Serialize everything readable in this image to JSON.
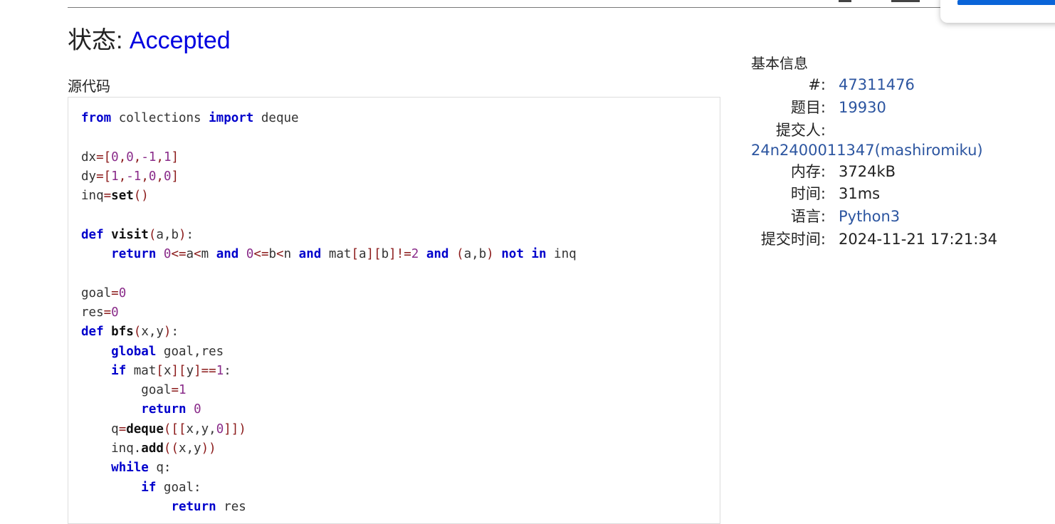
{
  "status": {
    "label": "状态: ",
    "value": "Accepted"
  },
  "source": {
    "title": "源代码",
    "lines": [
      [
        [
          "kw",
          "from"
        ],
        [
          "t",
          " collections "
        ],
        [
          "kw",
          "import"
        ],
        [
          "t",
          " deque"
        ]
      ],
      [],
      [
        [
          "t",
          "dx"
        ],
        [
          "pu",
          "=["
        ],
        [
          "nm",
          "0"
        ],
        [
          "pu",
          ","
        ],
        [
          "nm",
          "0"
        ],
        [
          "pu",
          ","
        ],
        [
          "nm",
          "-1"
        ],
        [
          "pu",
          ","
        ],
        [
          "nm",
          "1"
        ],
        [
          "pu",
          "]"
        ]
      ],
      [
        [
          "t",
          "dy"
        ],
        [
          "pu",
          "=["
        ],
        [
          "nm",
          "1"
        ],
        [
          "pu",
          ","
        ],
        [
          "nm",
          "-1"
        ],
        [
          "pu",
          ","
        ],
        [
          "nm",
          "0"
        ],
        [
          "pu",
          ","
        ],
        [
          "nm",
          "0"
        ],
        [
          "pu",
          "]"
        ]
      ],
      [
        [
          "t",
          "inq"
        ],
        [
          "pu",
          "="
        ],
        [
          "fn",
          "set"
        ],
        [
          "pu",
          "()"
        ]
      ],
      [],
      [
        [
          "kw",
          "def"
        ],
        [
          "t",
          " "
        ],
        [
          "fn",
          "visit"
        ],
        [
          "pu",
          "("
        ],
        [
          "t",
          "a,b"
        ],
        [
          "pu",
          ")"
        ],
        [
          "t",
          ":"
        ]
      ],
      [
        [
          "t",
          "    "
        ],
        [
          "kw",
          "return"
        ],
        [
          "t",
          " "
        ],
        [
          "nm",
          "0"
        ],
        [
          "pu",
          "<="
        ],
        [
          "t",
          "a"
        ],
        [
          "pu",
          "<"
        ],
        [
          "t",
          "m "
        ],
        [
          "kw",
          "and"
        ],
        [
          "t",
          " "
        ],
        [
          "nm",
          "0"
        ],
        [
          "pu",
          "<="
        ],
        [
          "t",
          "b"
        ],
        [
          "pu",
          "<"
        ],
        [
          "t",
          "n "
        ],
        [
          "kw",
          "and"
        ],
        [
          "t",
          " mat"
        ],
        [
          "pu",
          "["
        ],
        [
          "t",
          "a"
        ],
        [
          "pu",
          "]["
        ],
        [
          "t",
          "b"
        ],
        [
          "pu",
          "]!="
        ],
        [
          "nm",
          "2"
        ],
        [
          "t",
          " "
        ],
        [
          "kw",
          "and"
        ],
        [
          "t",
          " "
        ],
        [
          "pu",
          "("
        ],
        [
          "t",
          "a,b"
        ],
        [
          "pu",
          ")"
        ],
        [
          "t",
          " "
        ],
        [
          "kw",
          "not"
        ],
        [
          "t",
          " "
        ],
        [
          "kw",
          "in"
        ],
        [
          "t",
          " inq"
        ]
      ],
      [],
      [
        [
          "t",
          "goal"
        ],
        [
          "pu",
          "="
        ],
        [
          "nm",
          "0"
        ]
      ],
      [
        [
          "t",
          "res"
        ],
        [
          "pu",
          "="
        ],
        [
          "nm",
          "0"
        ]
      ],
      [
        [
          "kw",
          "def"
        ],
        [
          "t",
          " "
        ],
        [
          "fn",
          "bfs"
        ],
        [
          "pu",
          "("
        ],
        [
          "t",
          "x,y"
        ],
        [
          "pu",
          ")"
        ],
        [
          "t",
          ":"
        ]
      ],
      [
        [
          "t",
          "    "
        ],
        [
          "kw",
          "global"
        ],
        [
          "t",
          " goal,res"
        ]
      ],
      [
        [
          "t",
          "    "
        ],
        [
          "kw",
          "if"
        ],
        [
          "t",
          " mat"
        ],
        [
          "pu",
          "["
        ],
        [
          "t",
          "x"
        ],
        [
          "pu",
          "]["
        ],
        [
          "t",
          "y"
        ],
        [
          "pu",
          "]=="
        ],
        [
          "nm",
          "1"
        ],
        [
          "t",
          ":"
        ]
      ],
      [
        [
          "t",
          "        goal"
        ],
        [
          "pu",
          "="
        ],
        [
          "nm",
          "1"
        ]
      ],
      [
        [
          "t",
          "        "
        ],
        [
          "kw",
          "return"
        ],
        [
          "t",
          " "
        ],
        [
          "nm",
          "0"
        ]
      ],
      [
        [
          "t",
          "    q"
        ],
        [
          "pu",
          "="
        ],
        [
          "fn",
          "deque"
        ],
        [
          "pu",
          "([["
        ],
        [
          "t",
          "x,y,"
        ],
        [
          "nm",
          "0"
        ],
        [
          "pu",
          "]])"
        ]
      ],
      [
        [
          "t",
          "    inq."
        ],
        [
          "fn",
          "add"
        ],
        [
          "pu",
          "(("
        ],
        [
          "t",
          "x,y"
        ],
        [
          "pu",
          "))"
        ]
      ],
      [
        [
          "t",
          "    "
        ],
        [
          "kw",
          "while"
        ],
        [
          "t",
          " q:"
        ]
      ],
      [
        [
          "t",
          "        "
        ],
        [
          "kw",
          "if"
        ],
        [
          "t",
          " goal:"
        ]
      ],
      [
        [
          "t",
          "            "
        ],
        [
          "kw",
          "return"
        ],
        [
          "t",
          " res"
        ]
      ]
    ]
  },
  "info": {
    "title": "基本信息",
    "id_label": "#:",
    "id_value": "47311476",
    "problem_label": "题目:",
    "problem_value": "19930",
    "submitter_label": "提交人:",
    "submitter_value": "24n2400011347(mashiromiku)",
    "memory_label": "内存:",
    "memory_value": "3724kB",
    "time_label": "时间:",
    "time_value": "31ms",
    "language_label": "语言:",
    "language_value": "Python3",
    "submit_time_label": "提交时间:",
    "submit_time_value": "2024-11-21 17:21:34"
  }
}
